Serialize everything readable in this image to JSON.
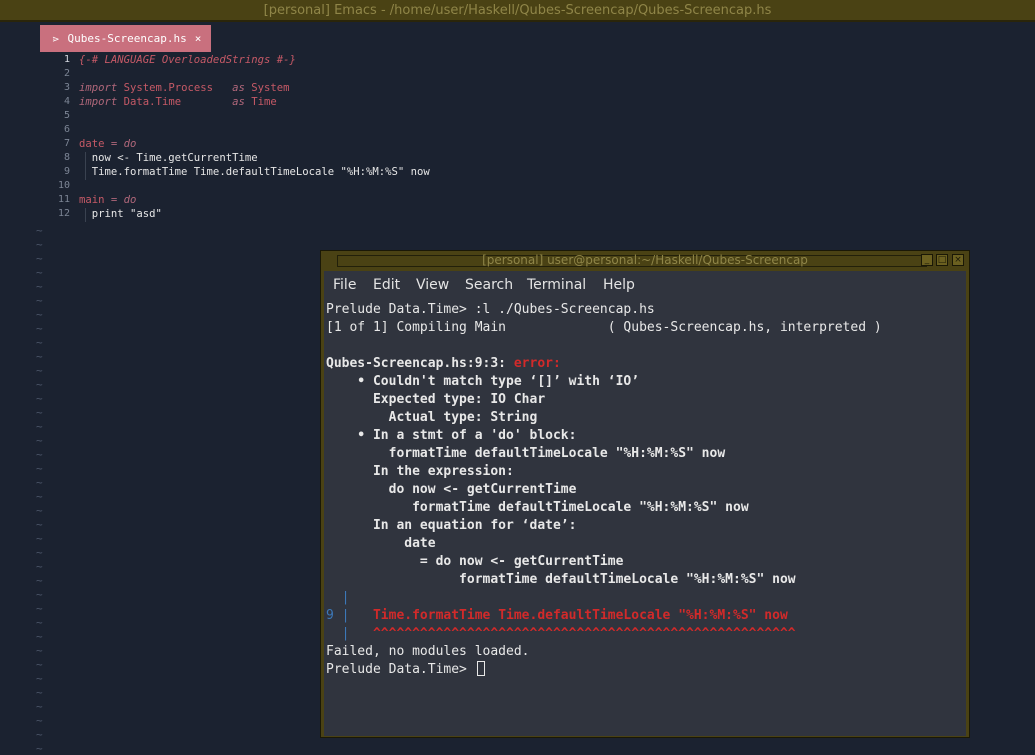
{
  "emacs": {
    "title": "[personal] Emacs - /home/user/Haskell/Qubes-Screencap/Qubes-Screencap.hs",
    "tab": {
      "label": "Qubes-Screencap.hs",
      "close": "×"
    },
    "line_numbers": [
      "1",
      "2",
      "3",
      "4",
      "5",
      "6",
      "7",
      "8",
      "9",
      "10",
      "11",
      "12"
    ],
    "code": {
      "l1": "{-# LANGUAGE OverloadedStrings #-}",
      "l3_kw": "import",
      "l3_mod": "System.Process",
      "l3_as": "as",
      "l3_alias": "System",
      "l4_kw": "import",
      "l4_mod": "Data.Time",
      "l4_as": "as",
      "l4_alias": "Time",
      "l7_name": "date",
      "l7_rest": " = ",
      "l7_do": "do",
      "l8": "  now <- Time.getCurrentTime",
      "l9_a": "  Time.formatTime Time.defaultTimeLocale ",
      "l9_str": "\"%H:%M:%S\"",
      "l9_b": " now",
      "l11_name": "main",
      "l11_rest": " = ",
      "l11_do": "do",
      "l12_a": "  print ",
      "l12_str": "\"asd\""
    },
    "tilde": "~"
  },
  "terminal": {
    "title": "[personal] user@personal:~/Haskell/Qubes-Screencap",
    "buttons": {
      "minimize": "_",
      "maximize": "□",
      "close": "×"
    },
    "menu": [
      "File",
      "Edit",
      "View",
      "Search",
      "Terminal",
      "Help"
    ],
    "lines": {
      "t1": "Prelude Data.Time> :l ./Qubes-Screencap.hs",
      "t2": "[1 of 1] Compiling Main             ( Qubes-Screencap.hs, interpreted )",
      "t4_loc": "Qubes-Screencap.hs:9:3: ",
      "t4_err": "error:",
      "t5": "    • Couldn't match type ‘[]’ with ‘IO’",
      "t6": "      Expected type: IO Char",
      "t7": "        Actual type: String",
      "t8": "    • In a stmt of a 'do' block:",
      "t9": "        formatTime defaultTimeLocale \"%H:%M:%S\" now",
      "t10": "      In the expression:",
      "t11": "        do now <- getCurrentTime",
      "t12": "           formatTime defaultTimeLocale \"%H:%M:%S\" now",
      "t13": "      In an equation for ‘date’:",
      "t14": "          date",
      "t15": "            = do now <- getCurrentTime",
      "t16": "                 formatTime defaultTimeLocale \"%H:%M:%S\" now",
      "t17_bar": "  |",
      "t18_num": "9",
      "t18_bar": " |",
      "t18_code": "   Time.formatTime Time.defaultTimeLocale \"%H:%M:%S\" now",
      "t19_bar": "  |",
      "t19_caret": "   ^^^^^^^^^^^^^^^^^^^^^^^^^^^^^^^^^^^^^^^^^^^^^^^^^^^^^^",
      "t20": "Failed, no modules loaded.",
      "t21": "Prelude Data.Time> "
    }
  }
}
